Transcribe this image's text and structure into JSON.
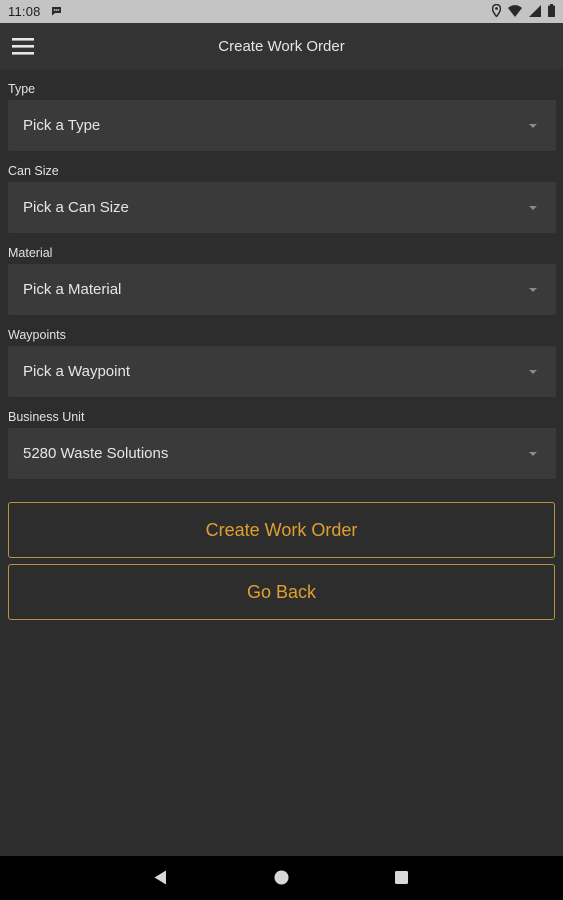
{
  "status_bar": {
    "time": "11:08",
    "icons": [
      "message-icon",
      "location-icon",
      "wifi-icon",
      "signal-icon",
      "battery-icon"
    ]
  },
  "app_bar": {
    "title": "Create Work Order",
    "menu_icon": "hamburger-menu-icon"
  },
  "form": {
    "fields": [
      {
        "label": "Type",
        "value": "Pick a Type"
      },
      {
        "label": "Can Size",
        "value": "Pick a Can Size"
      },
      {
        "label": "Material",
        "value": "Pick a Material"
      },
      {
        "label": "Waypoints",
        "value": "Pick a Waypoint"
      },
      {
        "label": "Business Unit",
        "value": "5280 Waste Solutions"
      }
    ]
  },
  "buttons": {
    "create_label": "Create Work Order",
    "back_label": "Go Back"
  },
  "colors": {
    "background": "#2d2d2d",
    "app_bar": "#333333",
    "input_bg": "#3a3a3a",
    "accent": "#e0a030",
    "button_border": "#b8923f",
    "status_bar": "#c4c4c4",
    "nav_bar": "#000000"
  },
  "nav_bar": {
    "icons": [
      "back-triangle-icon",
      "home-circle-icon",
      "recents-square-icon"
    ]
  }
}
